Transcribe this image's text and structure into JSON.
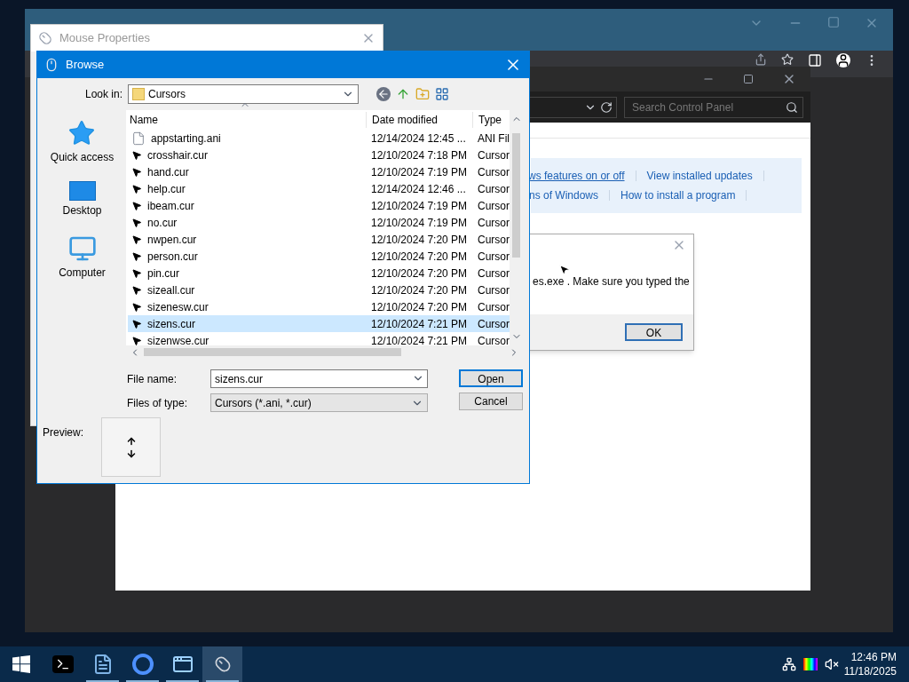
{
  "mouse_properties": {
    "title": "Mouse Properties"
  },
  "control_panel": {
    "search": {
      "placeholder": "Search Control Panel"
    },
    "link_rows": [
      [
        {
          "text": "ws features on or off",
          "hovered": true
        },
        {
          "text": "View installed updates",
          "hovered": false
        }
      ],
      [
        {
          "text": "ns of Windows",
          "hovered": false
        },
        {
          "text": "How to install a program",
          "hovered": false
        }
      ]
    ]
  },
  "error_dialog": {
    "message": "es.exe . Make sure you typed the",
    "button": "OK"
  },
  "browse_dialog": {
    "title": "Browse",
    "look_in_label": "Look in:",
    "look_in_value": "Cursors",
    "places": [
      {
        "label": "Quick access",
        "kind": "star"
      },
      {
        "label": "Desktop",
        "kind": "desktop"
      },
      {
        "label": "Computer",
        "kind": "computer"
      }
    ],
    "columns": [
      "Name",
      "Date modified",
      "Type"
    ],
    "files": [
      {
        "name": "appstarting.ani",
        "date": "12/14/2024 12:45 ...",
        "type": "ANI Fil",
        "kind": "ani",
        "selected": false
      },
      {
        "name": "crosshair.cur",
        "date": "12/10/2024 7:18 PM",
        "type": "Cursor",
        "kind": "cur",
        "selected": false
      },
      {
        "name": "hand.cur",
        "date": "12/10/2024 7:19 PM",
        "type": "Cursor",
        "kind": "cur",
        "selected": false
      },
      {
        "name": "help.cur",
        "date": "12/14/2024 12:46 ...",
        "type": "Cursor",
        "kind": "cur",
        "selected": false
      },
      {
        "name": "ibeam.cur",
        "date": "12/10/2024 7:19 PM",
        "type": "Cursor",
        "kind": "cur",
        "selected": false
      },
      {
        "name": "no.cur",
        "date": "12/10/2024 7:19 PM",
        "type": "Cursor",
        "kind": "cur",
        "selected": false
      },
      {
        "name": "nwpen.cur",
        "date": "12/10/2024 7:20 PM",
        "type": "Cursor",
        "kind": "cur",
        "selected": false
      },
      {
        "name": "person.cur",
        "date": "12/10/2024 7:20 PM",
        "type": "Cursor",
        "kind": "cur",
        "selected": false
      },
      {
        "name": "pin.cur",
        "date": "12/10/2024 7:20 PM",
        "type": "Cursor",
        "kind": "cur",
        "selected": false
      },
      {
        "name": "sizeall.cur",
        "date": "12/10/2024 7:20 PM",
        "type": "Cursor",
        "kind": "cur",
        "selected": false
      },
      {
        "name": "sizenesw.cur",
        "date": "12/10/2024 7:20 PM",
        "type": "Cursor",
        "kind": "cur",
        "selected": false
      },
      {
        "name": "sizens.cur",
        "date": "12/10/2024 7:21 PM",
        "type": "Cursor",
        "kind": "cur",
        "selected": true
      },
      {
        "name": "sizenwse.cur",
        "date": "12/10/2024 7:21 PM",
        "type": "Cursor",
        "kind": "cur",
        "selected": false
      }
    ],
    "file_name_label": "File name:",
    "file_name_value": "sizens.cur",
    "file_type_label": "Files of type:",
    "file_type_value": "Cursors (*.ani, *.cur)",
    "open_button": "Open",
    "cancel_button": "Cancel",
    "preview_label": "Preview:"
  },
  "taskbar": {
    "apps": [
      {
        "kind": "terminal",
        "running": false,
        "active": false
      },
      {
        "kind": "notepad",
        "running": true,
        "active": false
      },
      {
        "kind": "browser",
        "running": true,
        "active": false
      },
      {
        "kind": "control_panel",
        "running": true,
        "active": false
      },
      {
        "kind": "mouse",
        "running": true,
        "active": true
      }
    ],
    "time": "12:46 PM",
    "date": "11/18/2025"
  }
}
